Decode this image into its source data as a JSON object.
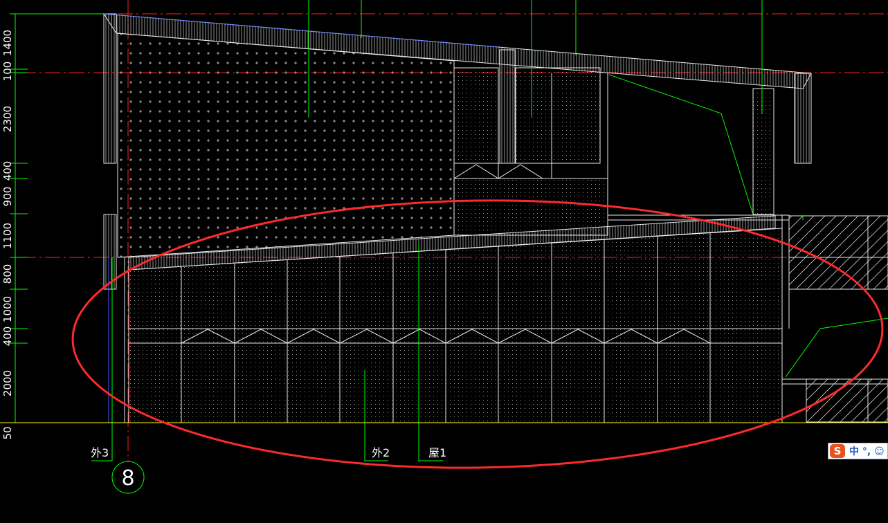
{
  "drawing": {
    "dimensions": [
      "1400",
      "100",
      "2300",
      "400",
      "900",
      "1100",
      "800",
      "1000",
      "400",
      "2000",
      "50"
    ],
    "callouts": [
      "外3",
      "外2",
      "屋1"
    ],
    "axis_label": "8"
  },
  "colors": {
    "background": "#000000",
    "outline": "#e8e8e8",
    "dimension": "#00ff00",
    "centerline": "#ff2020",
    "ground": "#ffff00",
    "annotation_ellipse": "#ff2a2a",
    "edge_blue": "#4060ff"
  },
  "ime": {
    "logo": "S",
    "status": "中 °, ☺"
  }
}
